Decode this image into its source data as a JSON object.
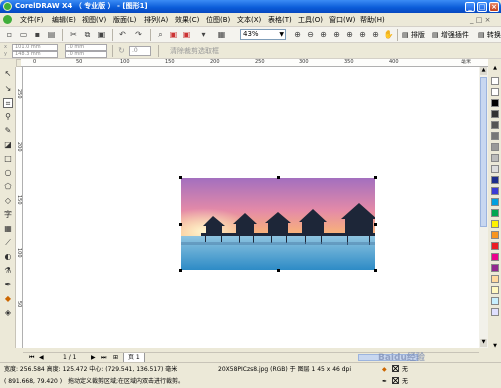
{
  "window": {
    "title": "CorelDRAW X4 （ 专业版 ） - [图形1]",
    "min": "_",
    "max": "□",
    "close": "×"
  },
  "menu": [
    "文件(F)",
    "编辑(E)",
    "视图(V)",
    "版面(L)",
    "排列(A)",
    "效果(C)",
    "位图(B)",
    "文本(X)",
    "表格(T)",
    "工具(O)",
    "窗口(W)",
    "帮助(H)"
  ],
  "toolbar": {
    "zoom_value": "43%",
    "paste_layout_label": "排版",
    "enhance_plugin_label": "增强插件",
    "convert_label": "转换"
  },
  "property_bar": {
    "x_pos": "101.0 mm",
    "y_pos": "148.3 mm",
    "width": ".0 mm",
    "height": ".0 mm",
    "angle": ".0",
    "clear_crop_label": "清除裁剪选取框"
  },
  "ruler": {
    "h_ticks": [
      "0",
      "50",
      "100",
      "150",
      "200",
      "250",
      "300",
      "350",
      "400"
    ],
    "v_ticks": [
      "250",
      "200",
      "150",
      "100",
      "50"
    ],
    "unit": "毫米"
  },
  "image": {
    "alt": "海上水屋日落"
  },
  "pager": {
    "page_indicator": "1 / 1",
    "page_tab": "页 1"
  },
  "status": {
    "size_info": "宽度: 256.584 高度: 125.472 中心: (729.541, 136.517) 毫米",
    "object_info": "20X58PICzs8.jpg (RGB) 于 图层 1 45 x 46 dpi",
    "cursor_pos": "( 891.668, 79.420 )",
    "hint": "拖动定义裁剪区域;在区域内双击进行裁剪。",
    "fill_none": "无",
    "outline_none": "无"
  },
  "watermark": "Baidu经验",
  "colors": {
    "title_blue": "#0a5bd8",
    "palette": [
      "#ffffff",
      "#000000",
      "#1d2d8c",
      "#3b3bd6",
      "#00a0e0",
      "#00a651",
      "#8dc63f",
      "#fff200",
      "#f7941d",
      "#ed1c24",
      "#ec008c",
      "#92278f",
      "#a67c52",
      "#c0c0c0",
      "#808080",
      "#ffd9a0",
      "#c8f0ff"
    ]
  }
}
